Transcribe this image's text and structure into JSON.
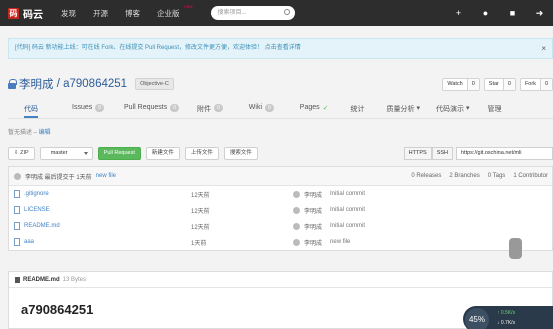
{
  "topbar": {
    "logo_text": "码云",
    "nav": [
      "发现",
      "开源",
      "博客",
      "企业版"
    ],
    "nav_badge": "new",
    "search_placeholder": "搜索项目..."
  },
  "notice": {
    "text": "[代码] 码云 新功能上线：可在线 Fork、在线提交 Pull Request，修改文件更方便，欢迎体验！ 点击查看详情"
  },
  "repo": {
    "owner": "李明成",
    "separator": " / ",
    "name": "a790864251",
    "language": "Objective-C",
    "actions": [
      {
        "label": "Watch",
        "count": "0"
      },
      {
        "label": "Star",
        "count": "0"
      },
      {
        "label": "Fork",
        "count": "0"
      }
    ]
  },
  "tabs": [
    {
      "label": "代码",
      "count": ""
    },
    {
      "label": "Issues",
      "count": "0"
    },
    {
      "label": "Pull Requests",
      "count": "0"
    },
    {
      "label": "附件",
      "count": "0"
    },
    {
      "label": "Wiki",
      "count": "0"
    },
    {
      "label": "Pages",
      "count": ""
    },
    {
      "label": "统计",
      "count": ""
    },
    {
      "label": "质量分析",
      "count": ""
    },
    {
      "label": "代码演示",
      "count": ""
    },
    {
      "label": "管理",
      "count": ""
    }
  ],
  "subline": {
    "text": "暂无描述 – ",
    "link": "编辑"
  },
  "toolbar": {
    "zip": "ZIP",
    "branch": "master",
    "pull_request": "Pull Request",
    "new_file": "新建文件",
    "upload": "上传文件",
    "search_code": "搜索文件",
    "protocols": [
      "HTTPS",
      "SSH"
    ],
    "clone_url": "https://git.oschina.net/mli"
  },
  "commit": {
    "text": "李明成 最后提交于 1天前",
    "link": "new file",
    "stats": [
      "0 Releases",
      "2 Branches",
      "0 Tags",
      "1 Contributor"
    ]
  },
  "files": [
    {
      "name": ".gitignore",
      "time": "12天前",
      "author": "李明成",
      "message": "Initial commit"
    },
    {
      "name": "LICENSE",
      "time": "12天前",
      "author": "李明成",
      "message": "Initial commit"
    },
    {
      "name": "README.md",
      "time": "12天前",
      "author": "李明成",
      "message": "Initial commit"
    },
    {
      "name": "aaa",
      "time": "1天前",
      "author": "李明成",
      "message": "new file"
    }
  ],
  "readme": {
    "filename": "README.md",
    "size": "13 Bytes",
    "heading": "a790864251"
  },
  "speed_widget": {
    "percent": "45%",
    "up": "0.5K/s",
    "down": "0.7K/s"
  }
}
